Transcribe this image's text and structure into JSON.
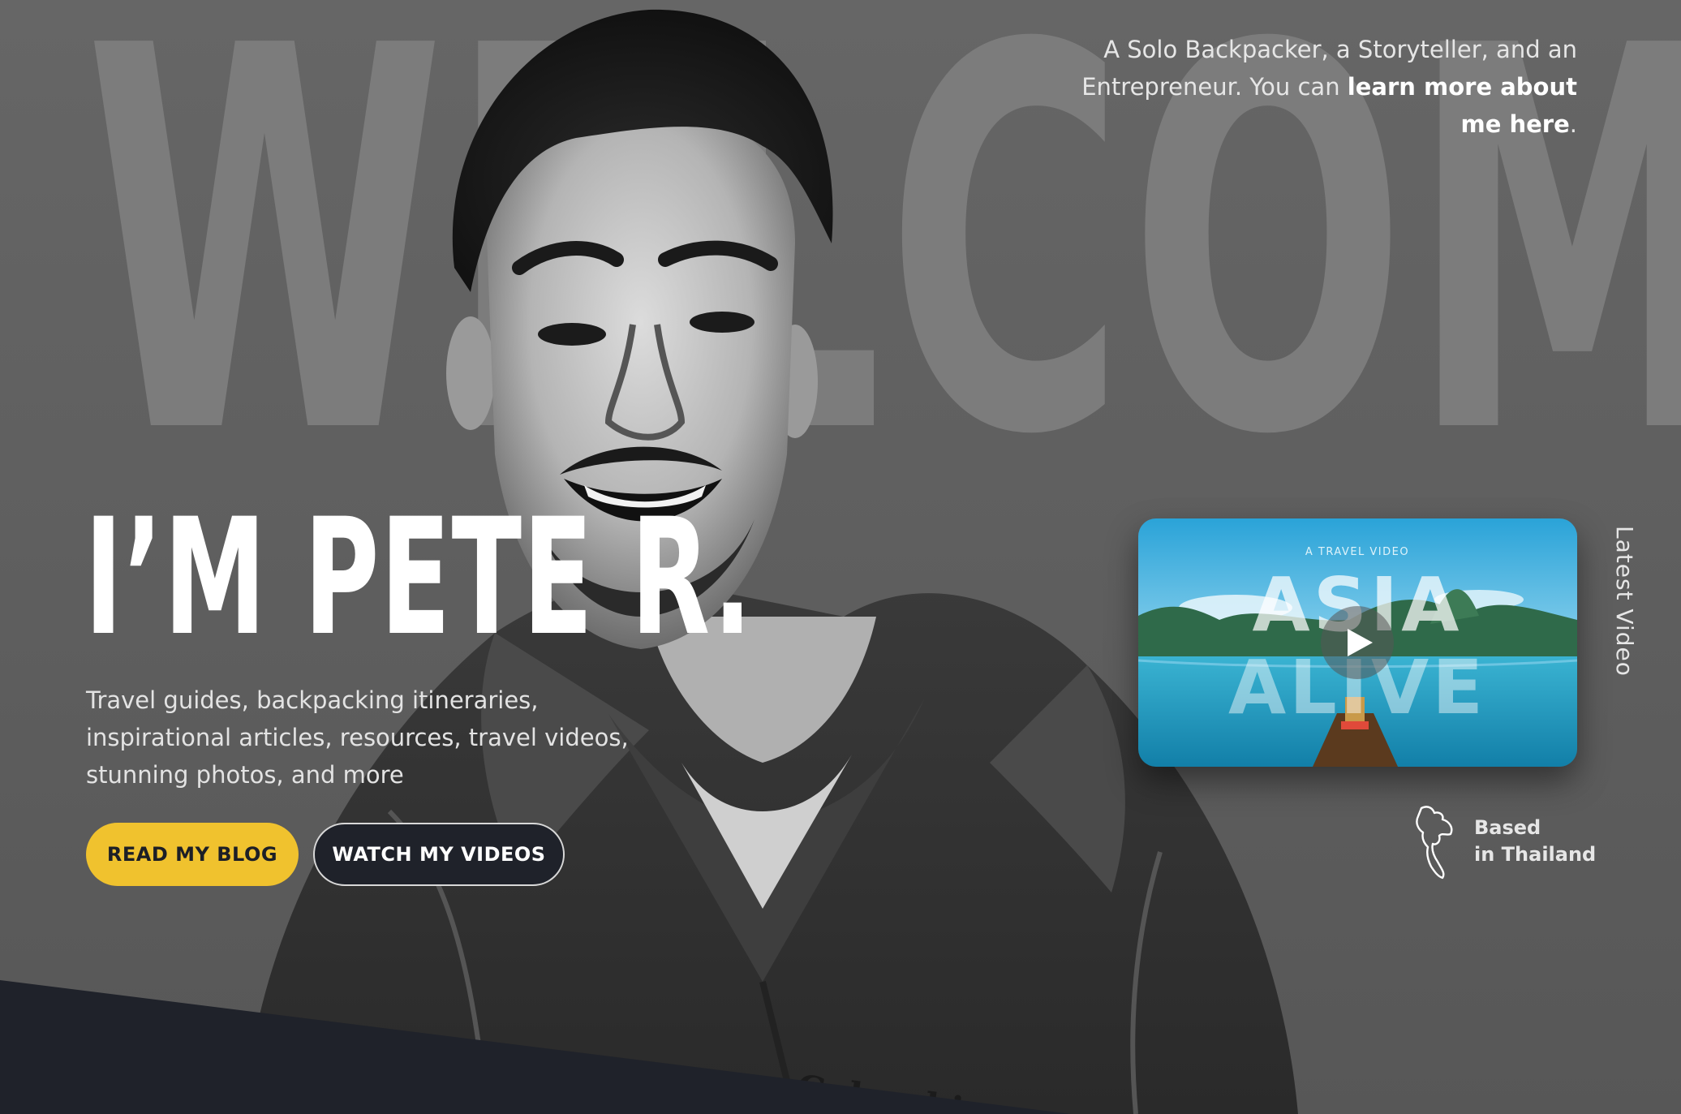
{
  "backdrop": {
    "word": "WELCOME"
  },
  "intro": {
    "prefix": "A Solo Backpacker, a Storyteller, and an Entrepreneur. You can ",
    "link_text": "learn more about me here",
    "suffix": "."
  },
  "hero": {
    "title": "I’M PETE R.",
    "subtitle": "Travel guides, backpacking itineraries, inspirational articles, resources, travel videos, stunning photos, and more"
  },
  "buttons": {
    "blog": "READ MY BLOG",
    "videos": "WATCH MY VIDEOS"
  },
  "video": {
    "side_label": "Latest Video",
    "kicker": "A TRAVEL VIDEO",
    "title_line1": "ASIA",
    "title_line2": "ALIVE"
  },
  "location": {
    "line1": "Based",
    "line2": "in Thailand",
    "icon": "thailand-map-icon"
  },
  "jacket_brand": "Columbia",
  "colors": {
    "background": "#5f5f5f",
    "backdrop_word": "#7c7c7c",
    "accent_yellow": "#f0c22e",
    "dark_band": "#1f222a",
    "text_light": "#e6e6e6"
  }
}
